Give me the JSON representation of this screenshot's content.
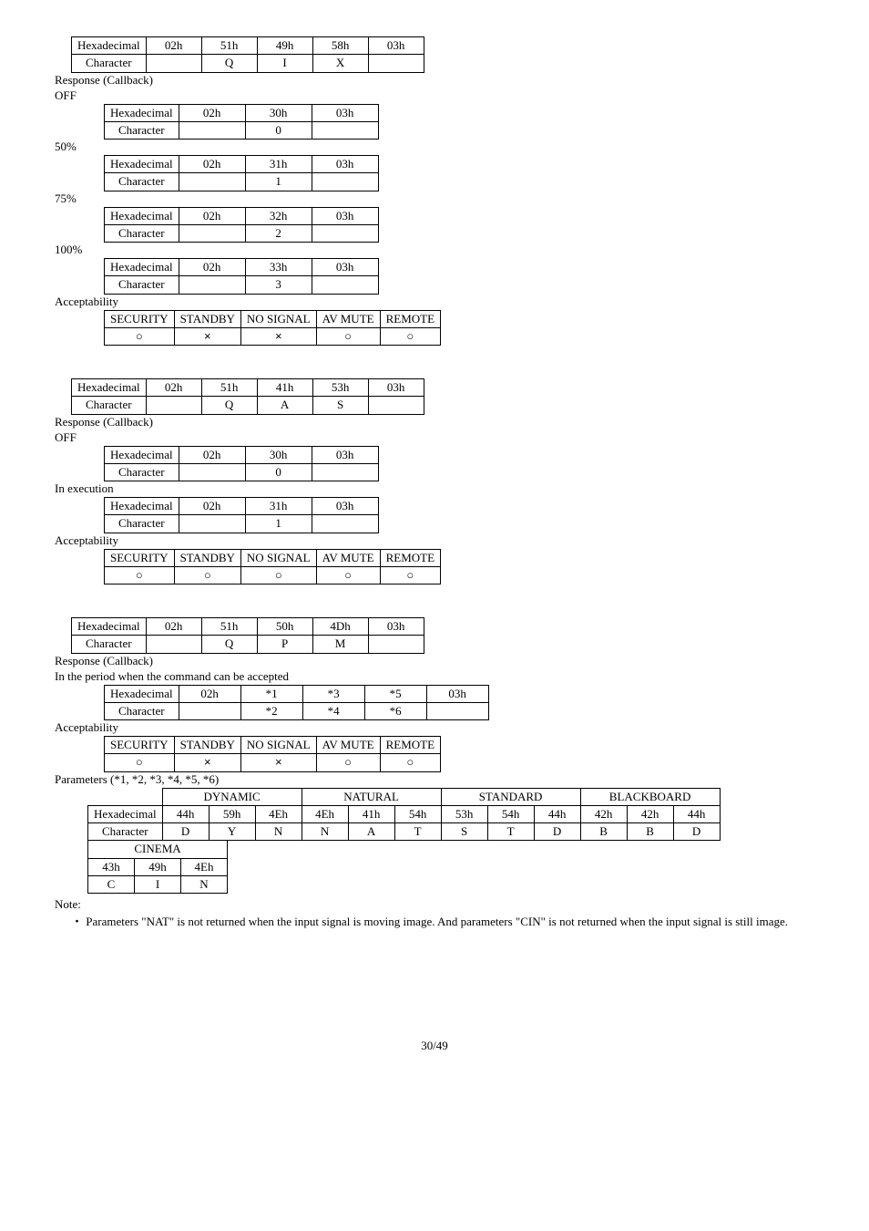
{
  "labels": {
    "hex": "Hexadecimal",
    "char": "Character",
    "response": "Response (Callback)",
    "accept": "Acceptability",
    "off": "OFF",
    "pct50": "50%",
    "pct75": "75%",
    "pct100": "100%",
    "inexec": "In execution",
    "inperiod": "In the period when the command can be accepted",
    "params_header": "Parameters (*1, *2, *3, *4, *5, *6)",
    "note": "Note:",
    "note_text": "Parameters \"NAT\" is not returned when the input signal is moving image. And parameters \"CIN\" is not returned when the input signal is still image.",
    "page": "30/49"
  },
  "modes": {
    "security": "SECURITY",
    "standby": "STANDBY",
    "nosignal": "NO SIGNAL",
    "avmute": "AV MUTE",
    "remote": "REMOTE",
    "dynamic": "DYNAMIC",
    "natural": "NATURAL",
    "standard": "STANDARD",
    "blackboard": "BLACKBOARD",
    "cinema": "CINEMA"
  },
  "marks": {
    "circ": "○",
    "x": "×",
    "bullet": "・"
  },
  "sec1": {
    "top_hex": [
      "02h",
      "51h",
      "49h",
      "58h",
      "03h"
    ],
    "top_char": [
      "",
      "Q",
      "I",
      "X",
      ""
    ],
    "off": {
      "hex": [
        "02h",
        "30h",
        "03h"
      ],
      "char": [
        "",
        "0",
        ""
      ]
    },
    "p50": {
      "hex": [
        "02h",
        "31h",
        "03h"
      ],
      "char": [
        "",
        "1",
        ""
      ]
    },
    "p75": {
      "hex": [
        "02h",
        "32h",
        "03h"
      ],
      "char": [
        "",
        "2",
        ""
      ]
    },
    "p100": {
      "hex": [
        "02h",
        "33h",
        "03h"
      ],
      "char": [
        "",
        "3",
        ""
      ]
    },
    "acc": [
      "○",
      "×",
      "×",
      "○",
      "○"
    ]
  },
  "sec2": {
    "top_hex": [
      "02h",
      "51h",
      "41h",
      "53h",
      "03h"
    ],
    "top_char": [
      "",
      "Q",
      "A",
      "S",
      ""
    ],
    "off": {
      "hex": [
        "02h",
        "30h",
        "03h"
      ],
      "char": [
        "",
        "0",
        ""
      ]
    },
    "inexec": {
      "hex": [
        "02h",
        "31h",
        "03h"
      ],
      "char": [
        "",
        "1",
        ""
      ]
    },
    "acc": [
      "○",
      "○",
      "○",
      "○",
      "○"
    ]
  },
  "sec3": {
    "top_hex": [
      "02h",
      "51h",
      "50h",
      "4Dh",
      "03h"
    ],
    "top_char": [
      "",
      "Q",
      "P",
      "M",
      ""
    ],
    "period": {
      "hex": [
        "02h",
        "*1",
        "*3",
        "*5",
        "03h"
      ],
      "char": [
        "",
        "*2",
        "*4",
        "*6",
        ""
      ]
    },
    "acc": [
      "○",
      "×",
      "×",
      "○",
      "○"
    ],
    "dyn_hex": [
      "44h",
      "59h",
      "4Eh"
    ],
    "dyn_char": [
      "D",
      "Y",
      "N"
    ],
    "nat_hex": [
      "4Eh",
      "41h",
      "54h"
    ],
    "nat_char": [
      "N",
      "A",
      "T"
    ],
    "std_hex": [
      "53h",
      "54h",
      "44h"
    ],
    "std_char": [
      "S",
      "T",
      "D"
    ],
    "bb_hex": [
      "42h",
      "42h",
      "44h"
    ],
    "bb_char": [
      "B",
      "B",
      "D"
    ],
    "cin_hex": [
      "43h",
      "49h",
      "4Eh"
    ],
    "cin_char": [
      "C",
      "I",
      "N"
    ]
  }
}
